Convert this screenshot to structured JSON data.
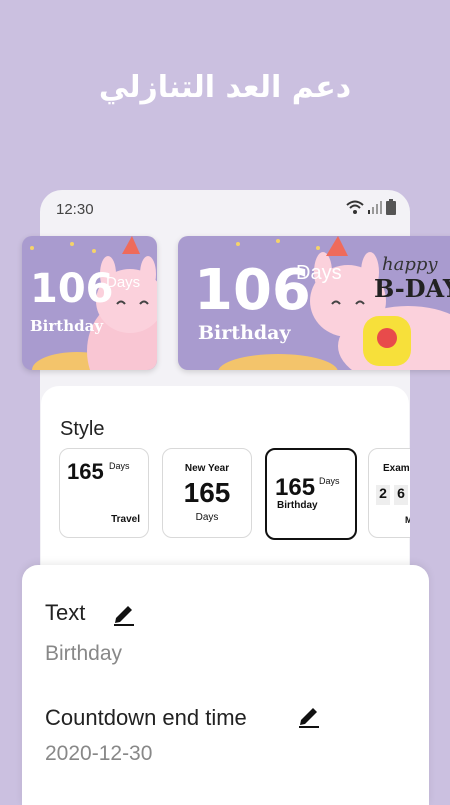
{
  "headline": "دعم العد التنازلي",
  "status_bar": {
    "time": "12:30"
  },
  "widgets": {
    "small": {
      "number": "106",
      "unit": "Days",
      "label": "Birthday"
    },
    "large": {
      "number": "106",
      "unit": "Days",
      "label": "Birthday",
      "decor_text": "happy",
      "decor_text2": "B-DAY"
    }
  },
  "style_section": {
    "title": "Style",
    "options": [
      {
        "number": "165",
        "unit": "Days",
        "label": "Travel"
      },
      {
        "top_label": "New Year",
        "number": "165",
        "unit": "Days"
      },
      {
        "number": "165",
        "unit": "Days",
        "label": "Birthday",
        "selected": true
      },
      {
        "top_label": "Exam",
        "digits": [
          "2",
          "6"
        ],
        "unit": "M"
      }
    ]
  },
  "fields": {
    "text": {
      "label": "Text",
      "value": "Birthday",
      "icon": "pencil-icon"
    },
    "end_time": {
      "label": "Countdown end time",
      "value": "2020-12-30",
      "icon": "pencil-icon"
    }
  }
}
